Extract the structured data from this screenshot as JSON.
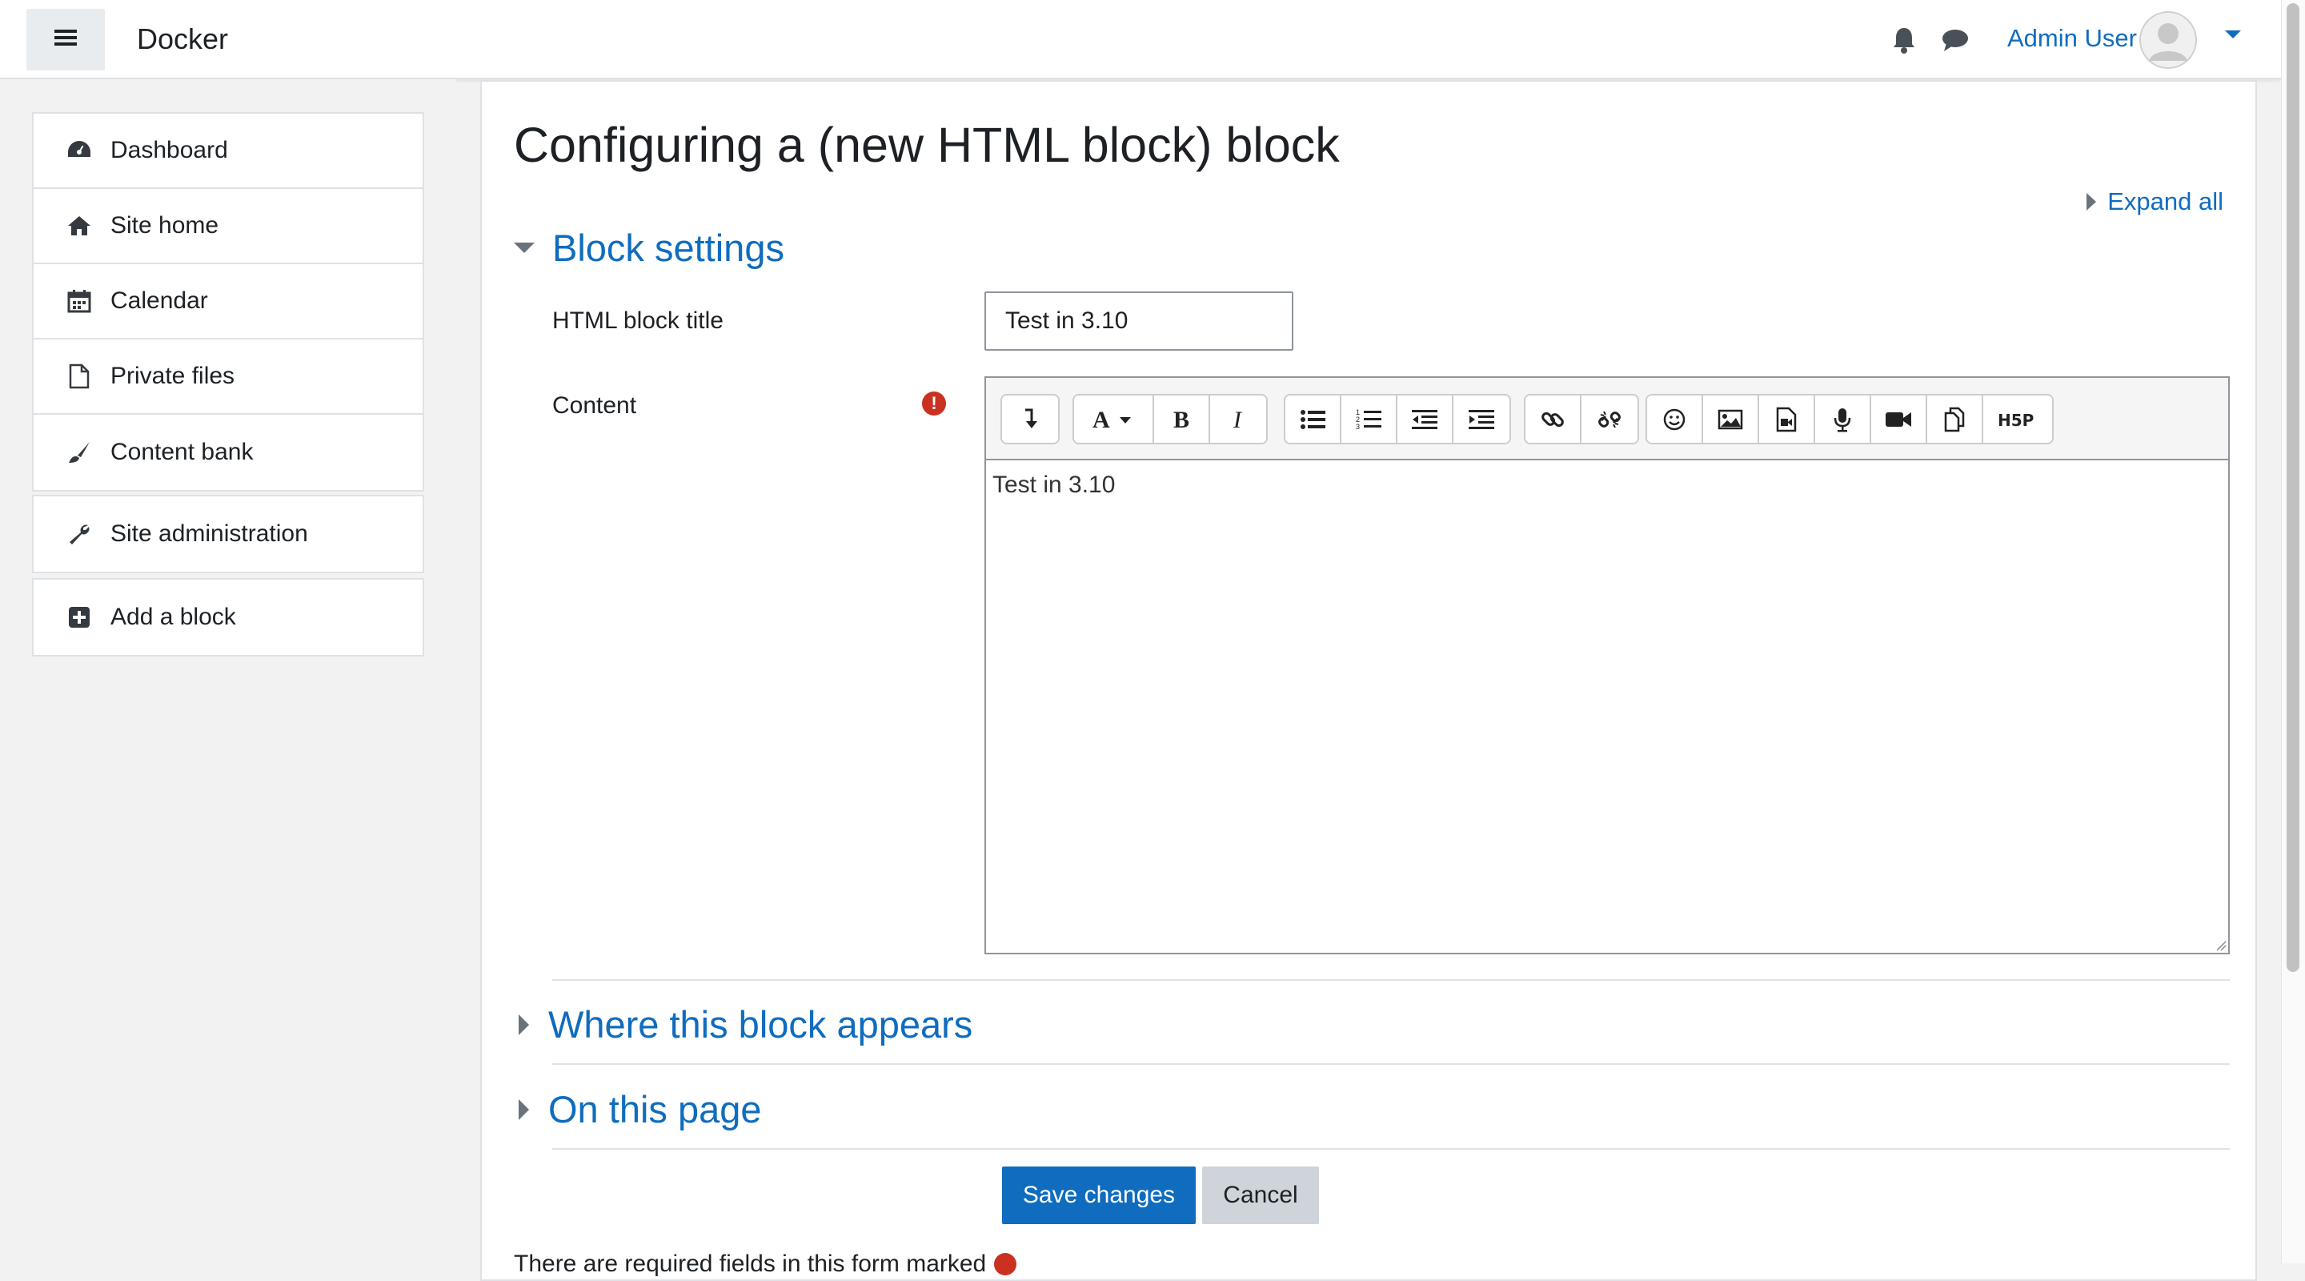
{
  "navbar": {
    "brand": "Docker",
    "user_name": "Admin User",
    "icons": [
      "menu-icon",
      "bell-icon",
      "chat-icon",
      "avatar",
      "caret-down-icon"
    ]
  },
  "drawer": {
    "group1": [
      {
        "label": "Dashboard",
        "icon": "dashboard-icon"
      },
      {
        "label": "Site home",
        "icon": "home-icon"
      },
      {
        "label": "Calendar",
        "icon": "calendar-icon"
      },
      {
        "label": "Private files",
        "icon": "file-icon"
      },
      {
        "label": "Content bank",
        "icon": "brush-icon"
      }
    ],
    "group2": [
      {
        "label": "Site administration",
        "icon": "wrench-icon"
      }
    ],
    "group3": [
      {
        "label": "Add a block",
        "icon": "plus-square-icon"
      }
    ]
  },
  "main": {
    "title": "Configuring a (new HTML block) block",
    "expand_all": "Expand all",
    "sections": {
      "block_settings": "Block settings",
      "where_appears": "Where this block appears",
      "on_this_page": "On this page"
    },
    "fields": {
      "title_label": "HTML block title",
      "title_value": "Test in 3.10",
      "content_label": "Content",
      "content_value": "Test in 3.10"
    },
    "toolbar_buttons": [
      "show-more-icon",
      "font-style-icon",
      "bold-icon",
      "italic-icon",
      "unordered-list-icon",
      "ordered-list-icon",
      "outdent-icon",
      "indent-icon",
      "link-icon",
      "unlink-icon",
      "emoji-icon",
      "image-icon",
      "media-icon",
      "record-audio-icon",
      "record-video-icon",
      "manage-files-icon",
      "h5p-icon"
    ],
    "h5p_label": "H5P",
    "buttons": {
      "save": "Save changes",
      "cancel": "Cancel"
    },
    "footer_note": "There are required fields in this form marked"
  },
  "colors": {
    "link": "#0f6cbf",
    "primary_button": "#0f6cbf",
    "secondary_button": "#ced4da",
    "required": "#ca3120"
  }
}
